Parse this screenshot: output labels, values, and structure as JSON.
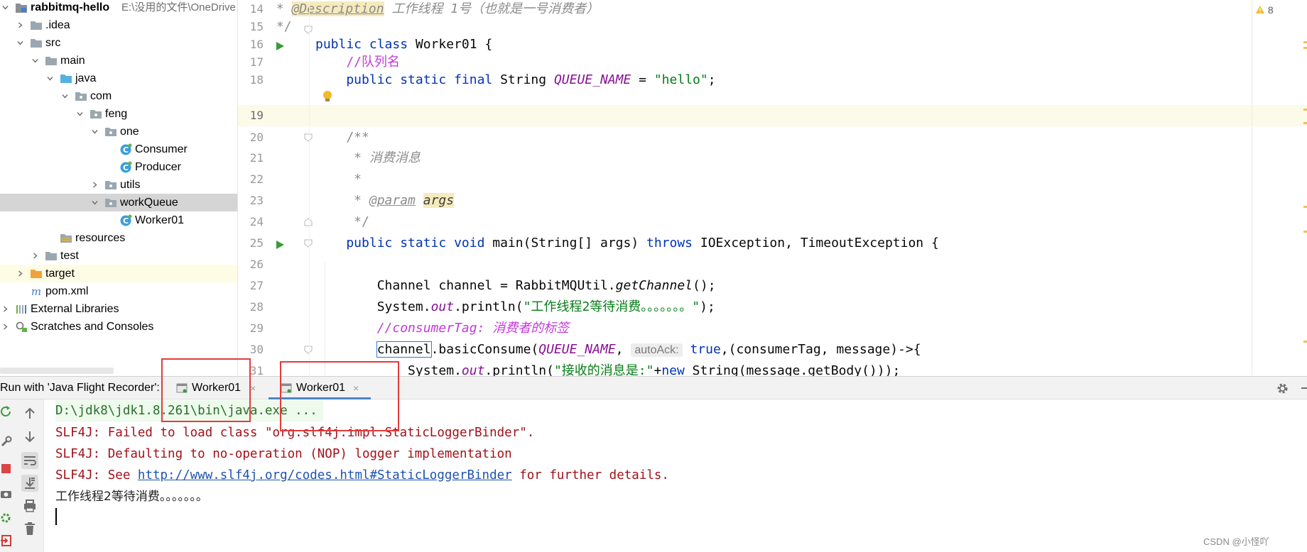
{
  "project_tree": {
    "root_name": "rabbitmq-hello",
    "root_path": "E:\\没用的文件\\OneDrive",
    "items": [
      {
        "label": "rabbitmq-hello",
        "kind": "module",
        "depth": 0,
        "arrow": "down"
      },
      {
        "label": ".idea",
        "kind": "folder",
        "depth": 1,
        "arrow": "right"
      },
      {
        "label": "src",
        "kind": "folder",
        "depth": 1,
        "arrow": "down"
      },
      {
        "label": "main",
        "kind": "folder",
        "depth": 2,
        "arrow": "down"
      },
      {
        "label": "java",
        "kind": "folder-src",
        "depth": 3,
        "arrow": "down"
      },
      {
        "label": "com",
        "kind": "package",
        "depth": 4,
        "arrow": "down"
      },
      {
        "label": "feng",
        "kind": "package",
        "depth": 5,
        "arrow": "down"
      },
      {
        "label": "one",
        "kind": "package",
        "depth": 6,
        "arrow": "down"
      },
      {
        "label": "Consumer",
        "kind": "class",
        "depth": 7,
        "arrow": "none"
      },
      {
        "label": "Producer",
        "kind": "class",
        "depth": 7,
        "arrow": "none"
      },
      {
        "label": "utils",
        "kind": "package",
        "depth": 6,
        "arrow": "right"
      },
      {
        "label": "workQueue",
        "kind": "package",
        "depth": 6,
        "arrow": "down",
        "selected": true
      },
      {
        "label": "Worker01",
        "kind": "class",
        "depth": 7,
        "arrow": "none"
      },
      {
        "label": "resources",
        "kind": "folder-res",
        "depth": 3,
        "arrow": "none"
      },
      {
        "label": "test",
        "kind": "folder",
        "depth": 2,
        "arrow": "right"
      },
      {
        "label": "target",
        "kind": "folder-orange",
        "depth": 1,
        "arrow": "right",
        "target": true
      },
      {
        "label": "pom.xml",
        "kind": "maven",
        "depth": 1,
        "arrow": "none"
      },
      {
        "label": "External Libraries",
        "kind": "libs",
        "depth": 0,
        "arrow": "right"
      },
      {
        "label": "Scratches and Consoles",
        "kind": "scratches",
        "depth": 0,
        "arrow": "right"
      }
    ]
  },
  "editor": {
    "warning_count": "8",
    "line_numbers": [
      "14",
      "15",
      "16",
      "17",
      "18",
      "19",
      "20",
      "21",
      "22",
      "23",
      "24",
      "25",
      "26",
      "27",
      "28",
      "29",
      "30",
      "31"
    ],
    "lines": {
      "l14_star": " * ",
      "l14_tag": "@Description",
      "l14_text": " 工作线程 1号（也就是一号消费者）",
      "l15": " */",
      "l16_kw": "public class",
      "l16_rest": " Worker01 {",
      "l17": "    //队列名",
      "l18_kw": "    public static final",
      "l18_type": " String ",
      "l18_field": "QUEUE_NAME",
      "l18_eq": " = ",
      "l18_str": "\"hello\"",
      "l18_end": ";",
      "l20": "    /**",
      "l21": "     * 消费消息",
      "l22": "     *",
      "l23_star": "     * ",
      "l23_tag": "@param",
      "l23_sp": " ",
      "l23_arg": "args",
      "l24": "     */",
      "l25_kw1": "    public static void",
      "l25_mid": " main(String[] args) ",
      "l25_kw2": "throws",
      "l25_rest": " IOException, TimeoutException {",
      "l27_a": "        Channel channel = RabbitMQUtil.",
      "l27_m": "getChannel",
      "l27_b": "();",
      "l28_a": "        System.",
      "l28_out": "out",
      "l28_b": ".println(",
      "l28_str": "\"工作线程2等待消费。。。。。。。\"",
      "l28_c": ");",
      "l29": "        //consumerTag: 消费者的标签",
      "l30_pre": "        ",
      "l30_chan": "channel",
      "l30_a": ".basicConsume(",
      "l30_field": "QUEUE_NAME",
      "l30_comma": ", ",
      "l30_hint": "autoAck:",
      "l30_true": " true",
      "l30_rest": ",(consumerTag, message)->{",
      "l31_a": "            System.",
      "l31_out": "out",
      "l31_b": ".println(",
      "l31_str": "\"接收的消息是:\"",
      "l31_c": "+",
      "l31_new": "new",
      "l31_d": " String(message.getBody()));"
    }
  },
  "run_window": {
    "title": "Run with 'Java Flight Recorder':",
    "tabs": [
      {
        "label": "Worker01",
        "active": false
      },
      {
        "label": "Worker01",
        "active": true
      }
    ],
    "close_glyph": "×",
    "console": {
      "cmd": "D:\\jdk8\\jdk1.8.261\\bin\\java.exe ...",
      "err1": "SLF4J: Failed to load class \"org.slf4j.impl.StaticLoggerBinder\".",
      "err2": "SLF4J: Defaulting to no-operation (NOP) logger implementation",
      "err3_a": "SLF4J: See ",
      "err3_link": "http://www.slf4j.org/codes.html#StaticLoggerBinder",
      "err3_b": " for further details.",
      "out1": "工作线程2等待消费。。。。。。。"
    }
  },
  "watermark": "CSDN @小怪吖",
  "colors": {
    "keyword": "#0033b3",
    "string": "#067d17",
    "field": "#871094",
    "line_comment": "#c23bd8",
    "doc_comment": "#8c8c8c",
    "console_error": "#a1121a",
    "console_link": "#1e53ad",
    "annotation_box": "#e33c3c"
  },
  "icons": [
    "module-icon",
    "folder-icon",
    "package-icon",
    "class-icon",
    "maven-icon",
    "libraries-icon",
    "scratches-icon",
    "run-gutter-icon",
    "bulb-icon",
    "warning-icon",
    "gear-icon",
    "rerun-icon",
    "wrench-icon",
    "stop-icon",
    "camera-icon",
    "up-arrow-icon",
    "down-arrow-icon",
    "soft-wrap-icon",
    "scroll-to-end-icon",
    "print-icon",
    "trash-icon"
  ]
}
